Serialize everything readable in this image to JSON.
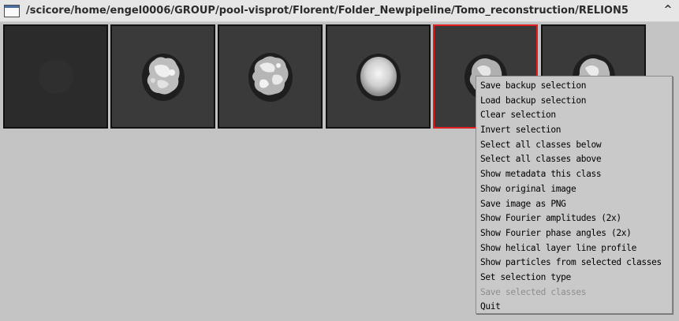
{
  "window": {
    "title": "/scicore/home/engel0006/GROUP/pool-visprot/Florent/Folder_Newpipeline/Tomo_reconstruction/RELION5",
    "up_icon": "chevron-up-icon",
    "min_icon": "minimize-icon",
    "up_glyph": "^",
    "min_glyph": "_"
  },
  "colors": {
    "background": "#c3c3c3",
    "thumb_bg": "#3a3a3a",
    "selection_border": "#e02020",
    "menu_bg": "#c9c9c9",
    "disabled_text": "#8e8e8e"
  },
  "thumbnails": [
    {
      "kind": "empty",
      "selected": false
    },
    {
      "kind": "particle",
      "selected": false
    },
    {
      "kind": "particle",
      "selected": false
    },
    {
      "kind": "sphere",
      "selected": false
    },
    {
      "kind": "particle",
      "selected": true
    },
    {
      "kind": "particle",
      "selected": false
    }
  ],
  "context_menu": {
    "items": [
      {
        "label": "Save backup selection",
        "enabled": true
      },
      {
        "label": "Load backup selection",
        "enabled": true
      },
      {
        "label": "Clear selection",
        "enabled": true
      },
      {
        "label": "Invert selection",
        "enabled": true
      },
      {
        "label": "Select all classes below",
        "enabled": true
      },
      {
        "label": "Select all classes above",
        "enabled": true
      },
      {
        "label": "Show metadata this class",
        "enabled": true
      },
      {
        "label": "Show original image",
        "enabled": true
      },
      {
        "label": "Save image as PNG",
        "enabled": true
      },
      {
        "label": "Show Fourier amplitudes (2x)",
        "enabled": true
      },
      {
        "label": "Show Fourier phase angles (2x)",
        "enabled": true
      },
      {
        "label": "Show helical layer line profile",
        "enabled": true
      },
      {
        "label": "Show particles from selected classes",
        "enabled": true
      },
      {
        "label": "Set selection type",
        "enabled": true
      },
      {
        "label": "Save selected classes",
        "enabled": false
      },
      {
        "label": "Quit",
        "enabled": true
      }
    ]
  }
}
